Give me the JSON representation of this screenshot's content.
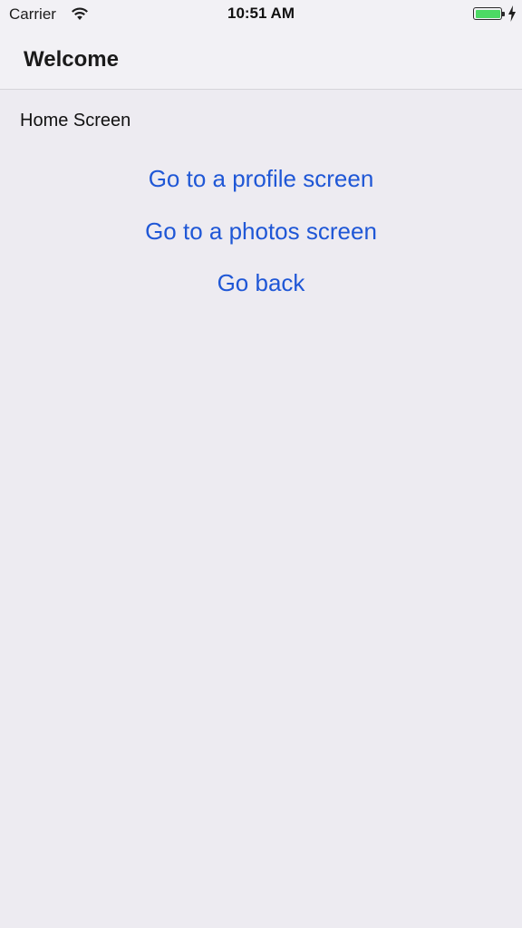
{
  "status_bar": {
    "carrier": "Carrier",
    "time": "10:51 AM",
    "wifi_icon": "wifi-icon",
    "battery_icon": "battery-icon",
    "charging_icon": "charging-bolt-icon",
    "battery_color": "#4cd964"
  },
  "nav": {
    "title": "Welcome"
  },
  "screen": {
    "label": "Home Screen"
  },
  "buttons": {
    "profile": "Go to a profile screen",
    "photos": "Go to a photos screen",
    "back": "Go back"
  },
  "colors": {
    "link": "#1f57d6",
    "background": "#edebf1",
    "bar": "#f2f1f5"
  }
}
